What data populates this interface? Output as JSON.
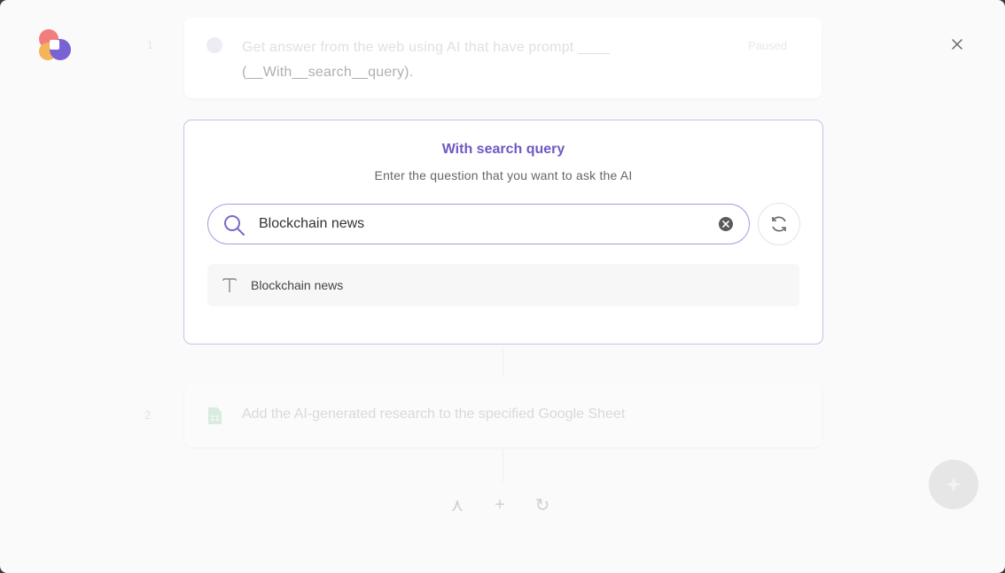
{
  "background": {
    "step1": {
      "number": "1",
      "text_line1": "Get answer from the web using AI that have prompt ____",
      "text_line2": "(__With__search__query).",
      "badge": "Paused"
    },
    "step2": {
      "number": "2",
      "text": "Add the AI-generated research to the specified Google Sheet"
    },
    "controls": {
      "collapse": "⋏",
      "add": "+",
      "reset": "↻"
    }
  },
  "query_card": {
    "title": "With search query",
    "subtitle": "Enter the question that you want to ask the AI",
    "search_value": "Blockchain news",
    "suggestion_text": "Blockchain news"
  },
  "colors": {
    "accent": "#7058c4",
    "border": "#a99bdc"
  },
  "icons": {
    "logo": "app-logo",
    "close": "close-icon",
    "search": "search-icon",
    "clear": "clear-icon",
    "refresh": "refresh-icon",
    "text_type": "text-type-icon",
    "sheet": "google-sheet-icon",
    "ai": "sparkle-icon"
  }
}
